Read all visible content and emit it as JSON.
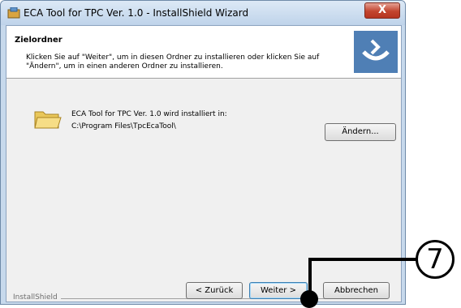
{
  "window": {
    "title": "ECA Tool for TPC Ver. 1.0 - InstallShield Wizard",
    "close_label": "X"
  },
  "header": {
    "title": "Zielordner",
    "description": "Klicken Sie auf \"Weiter\", um in diesen Ordner zu installieren oder klicken Sie auf \"Ändern\", um in einen anderen Ordner zu installieren."
  },
  "content": {
    "install_info": "ECA Tool for TPC Ver. 1.0 wird installiert in:",
    "install_path": "C:\\Program Files\\TpcEcaTool\\",
    "change_button": "Ändern..."
  },
  "footer": {
    "brand": "InstallShield",
    "back_button": "< Zurück",
    "next_button": "Weiter >",
    "cancel_button": "Abbrechen"
  },
  "callout": {
    "number": "7"
  },
  "icons": {
    "app": "installer-icon",
    "folder": "folder-icon",
    "logo": "installshield-logo-icon"
  },
  "colors": {
    "title_bar": "#c7d9ec",
    "close_button": "#c2452f",
    "dialog_background": "#f0f0f0",
    "header_background": "#ffffff"
  }
}
